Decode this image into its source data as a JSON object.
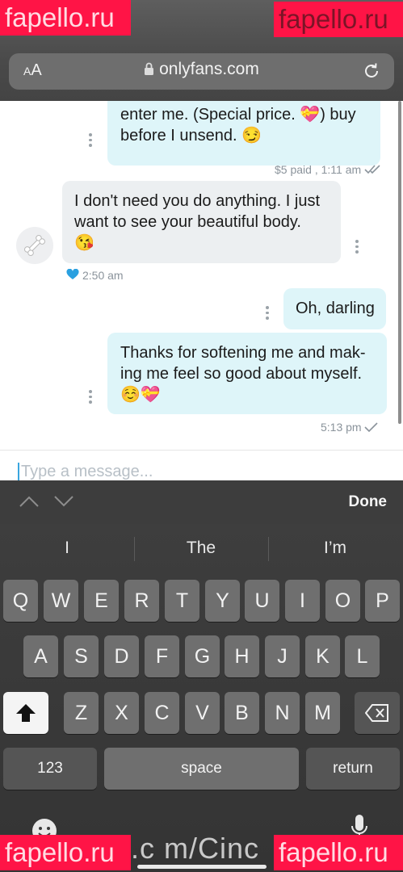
{
  "watermark": {
    "text": "fapello.ru",
    "footer_text": ".c m/Cinc",
    "color": "#ff1446"
  },
  "browser": {
    "aa_label_small": "A",
    "aa_label": "A",
    "url": "onlyfans.com"
  },
  "messages": [
    {
      "type": "sent",
      "text": "enter me. (Special price. 💝) buy\nbefore I unsend. 😏",
      "meta": "$5 paid , 1:11 am",
      "status": "read"
    },
    {
      "type": "received",
      "text": "I don't need you do anything. I just\nwant to see your beautiful body.\n😘",
      "meta": "2:50 am",
      "liked": true
    },
    {
      "type": "sent",
      "text": "Oh, darling"
    },
    {
      "type": "sent",
      "text": "Thanks for softening me and mak-\ning me feel so good about myself.\n☺️💝",
      "meta": "5:13 pm",
      "status": "sent"
    }
  ],
  "compose": {
    "placeholder": "Type a message..."
  },
  "keyboard": {
    "done_label": "Done",
    "predictions": [
      "I",
      "The",
      "I’m"
    ],
    "row1": [
      "Q",
      "W",
      "E",
      "R",
      "T",
      "Y",
      "U",
      "I",
      "O",
      "P"
    ],
    "row2": [
      "A",
      "S",
      "D",
      "F",
      "G",
      "H",
      "J",
      "K",
      "L"
    ],
    "row3": [
      "Z",
      "X",
      "C",
      "V",
      "B",
      "N",
      "M"
    ],
    "numbers_label": "123",
    "space_label": "space",
    "return_label": "return"
  },
  "colors": {
    "sent_bubble": "#def5f9",
    "received_bubble": "#eceff1",
    "accent": "#3aa6df",
    "like": "#2aa0e0"
  },
  "icons": [
    "lock-icon",
    "reload-icon",
    "bone-icon",
    "heart-icon",
    "double-check-icon",
    "check-icon",
    "chevron-up-icon",
    "chevron-down-icon",
    "shift-icon",
    "backspace-icon",
    "emoji-icon",
    "mic-icon"
  ]
}
